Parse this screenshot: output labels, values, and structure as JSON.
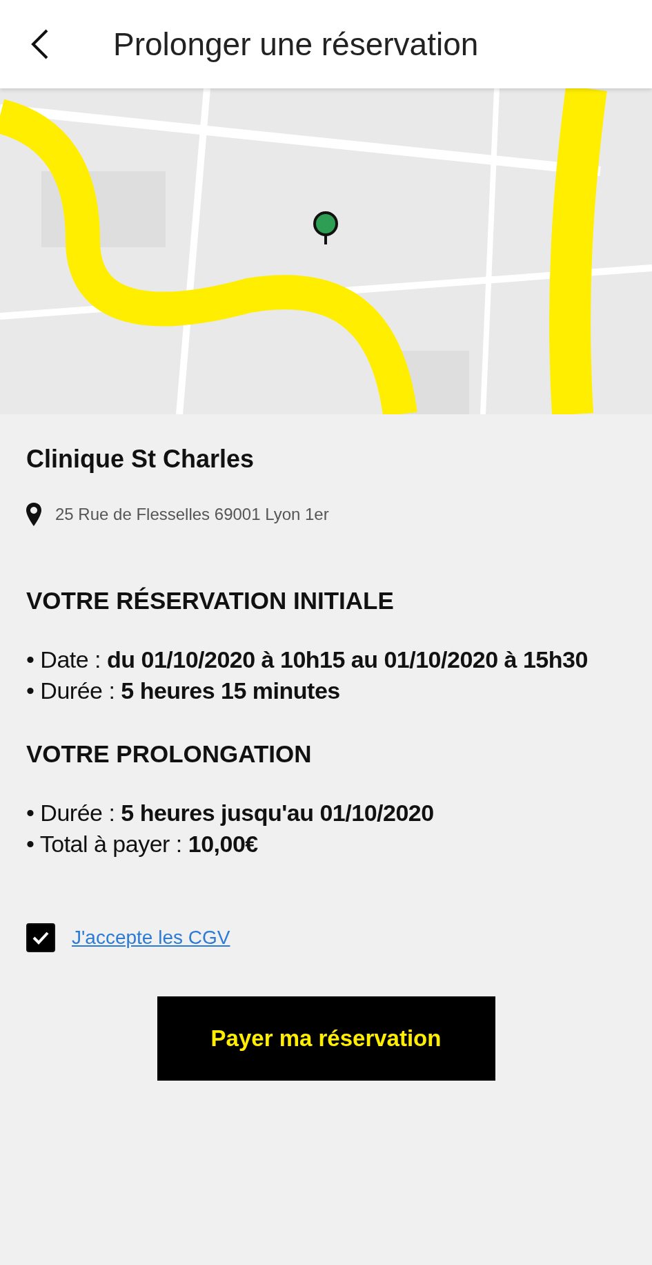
{
  "header": {
    "title": "Prolonger une réservation"
  },
  "place": {
    "name": "Clinique St Charles",
    "address": "25 Rue de Flesselles 69001 Lyon 1er"
  },
  "sections": [
    {
      "heading": "VOTRE RÉSERVATION INITIALE",
      "lines": [
        "• Date : **du 01/10/2020 à 10h15 au 01/10/2020 à 15h30**",
        "• Durée : **5 heures 15 minutes**"
      ]
    },
    {
      "heading": "VOTRE PROLONGATION",
      "lines": [
        "• Durée : **5 heures jusqu'au 01/10/2020**",
        "• Total à payer : **10,00€**"
      ]
    }
  ],
  "terms": {
    "checked": true,
    "link": "J'accepte les CGV"
  },
  "pay_button": "Payer ma réservation"
}
